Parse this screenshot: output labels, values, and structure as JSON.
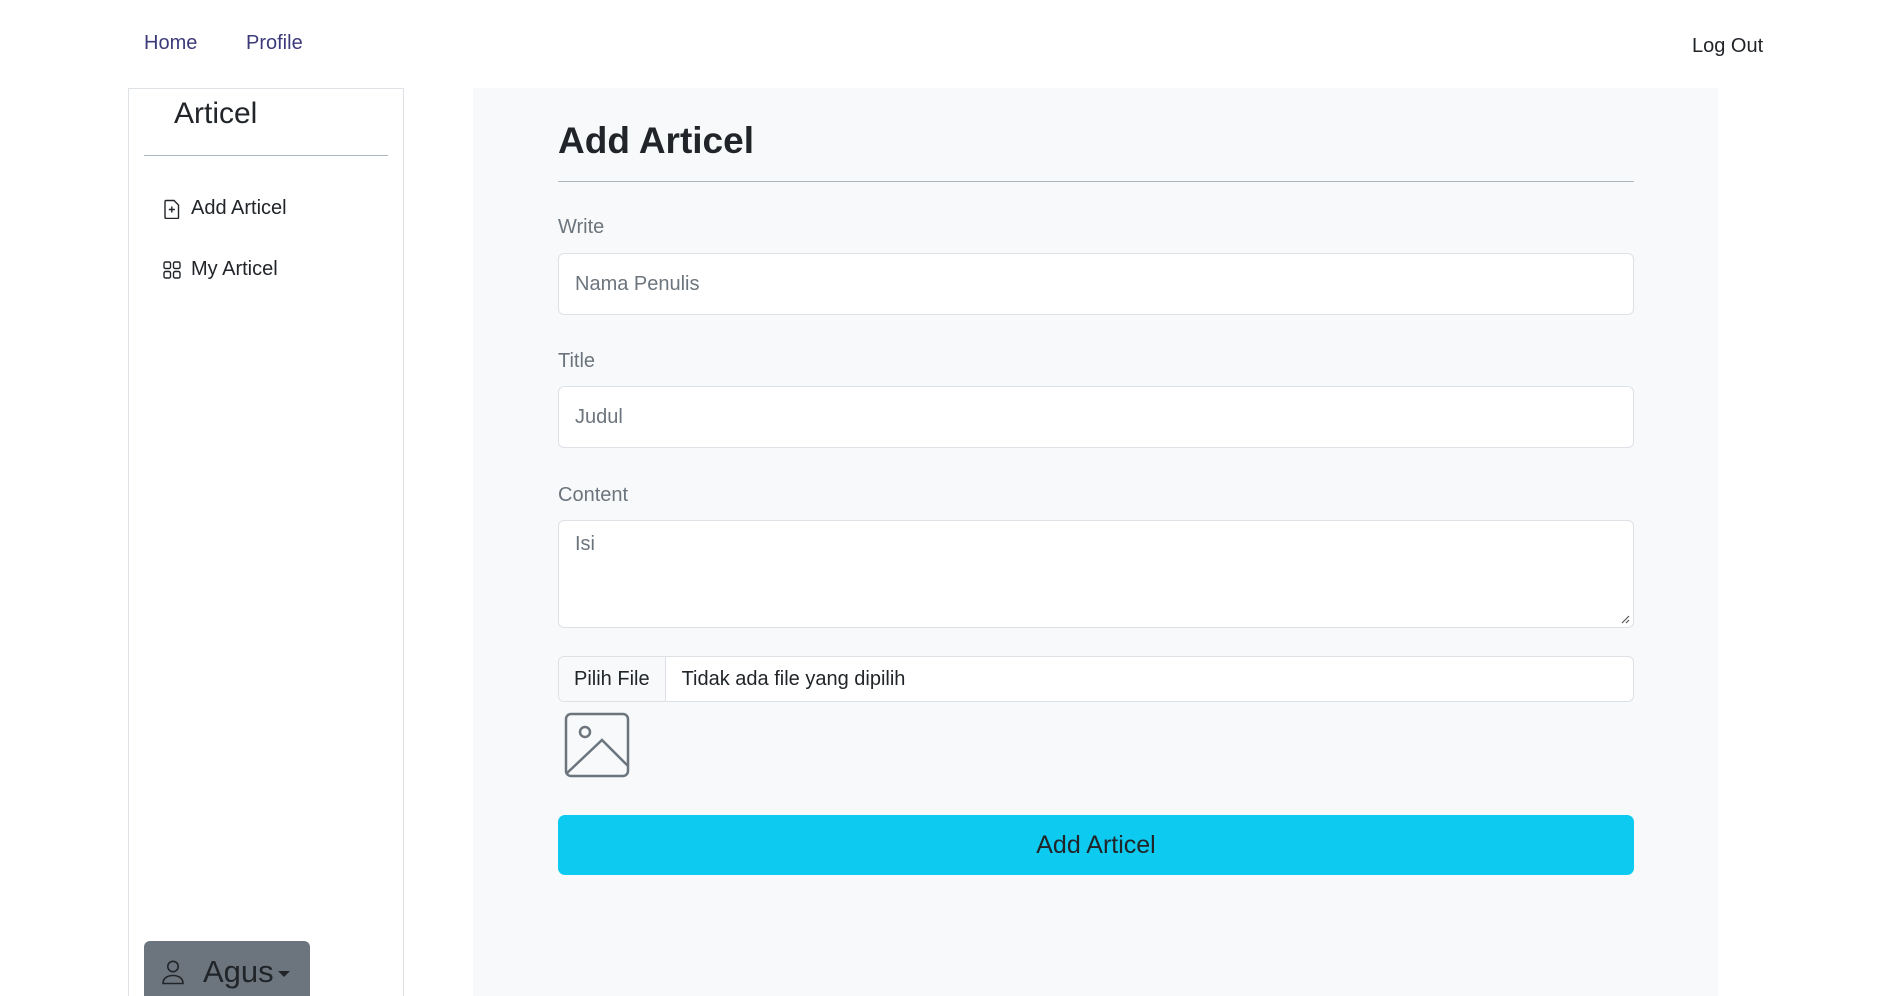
{
  "nav": {
    "home": "Home",
    "profile": "Profile",
    "logout": "Log Out"
  },
  "sidebar": {
    "title": "Articel",
    "items": [
      {
        "label": "Add Articel",
        "icon": "file-plus-icon"
      },
      {
        "label": "My Articel",
        "icon": "grid-icon"
      }
    ],
    "user": {
      "name": "Agus",
      "icon": "person-icon"
    }
  },
  "main": {
    "title": "Add Articel",
    "write": {
      "label": "Write",
      "placeholder": "Nama Penulis"
    },
    "title_field": {
      "label": "Title",
      "placeholder": "Judul"
    },
    "content": {
      "label": "Content",
      "placeholder": "Isi"
    },
    "file": {
      "button": "Pilih File",
      "status": "Tidak ada file yang dipilih"
    },
    "preview_icon": "image-icon",
    "submit": "Add Articel"
  },
  "colors": {
    "accent": "#0dcaf0",
    "user_button": "#6c757d",
    "main_bg": "#f8f9fa",
    "nav_link": "#3d3a7a"
  }
}
